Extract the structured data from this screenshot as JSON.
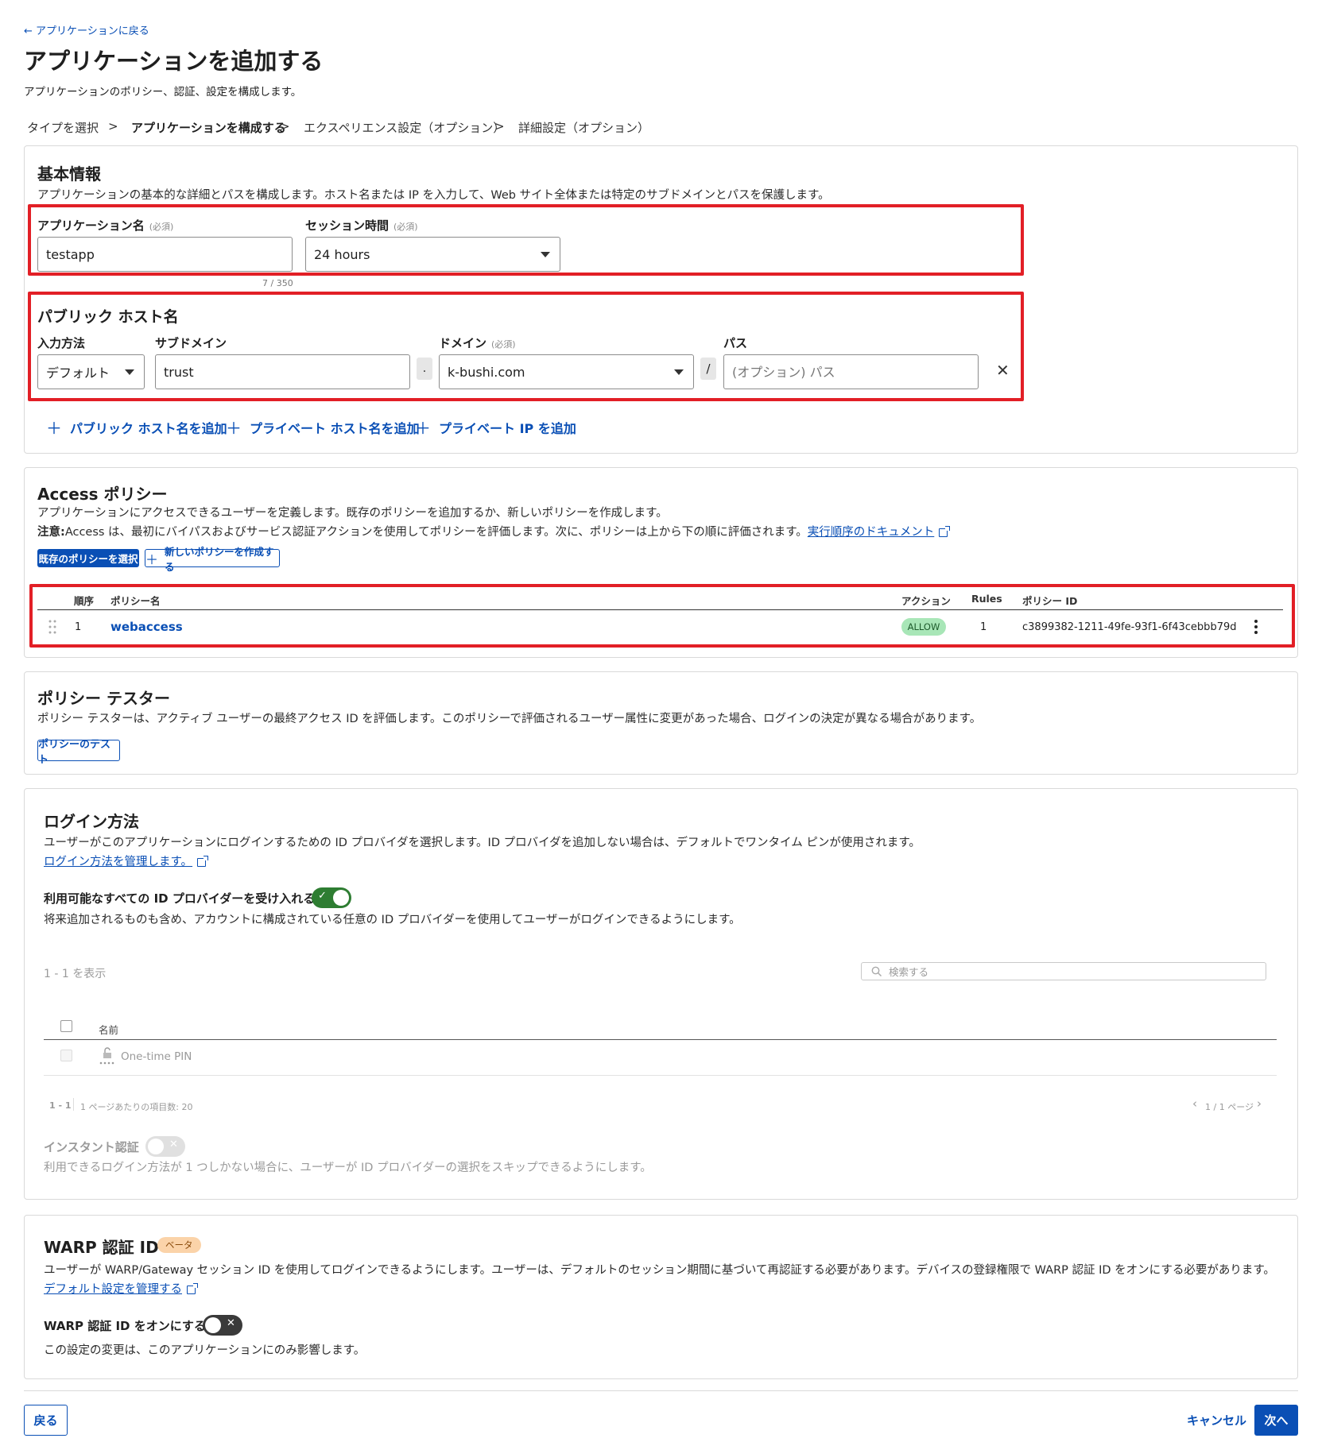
{
  "header": {
    "back_link": "← アプリケーションに戻る",
    "title": "アプリケーションを追加する",
    "subtitle": "アプリケーションのポリシー、認証、設定を構成します。"
  },
  "steps": [
    {
      "label": "タイプを選択",
      "active": false
    },
    {
      "label": "アプリケーションを構成する",
      "active": true
    },
    {
      "label": "エクスペリエンス設定（オプション）",
      "active": false
    },
    {
      "label": "詳細設定（オプション）",
      "active": false
    }
  ],
  "step_separator": ">",
  "basic": {
    "title": "基本情報",
    "description": "アプリケーションの基本的な詳細とパスを構成します。ホスト名または IP を入力して、Web サイト全体または特定のサブドメインとパスを保護します。",
    "app_name_label": "アプリケーション名",
    "required": "(必須)",
    "app_name_value": "testapp",
    "app_name_counter": "7 / 350",
    "session_label": "セッション時間",
    "session_value": "24 hours"
  },
  "public_host": {
    "title": "パブリック ホスト名",
    "input_method_label": "入力方法",
    "input_method_value": "デフォルト",
    "subdomain_label": "サブドメイン",
    "subdomain_value": "trust",
    "dot": ".",
    "domain_label": "ドメイン",
    "domain_value": "k-bushi.com",
    "slash": "/",
    "path_label": "パス",
    "path_placeholder": "(オプション) パス",
    "remove": "✕"
  },
  "add_links": {
    "plus": "＋",
    "public": "パブリック ホスト名を追加",
    "private_host": "プライベート ホスト名を追加",
    "private_ip": "プライベート IP を追加"
  },
  "access": {
    "title": "Access ポリシー",
    "description": "アプリケーションにアクセスできるユーザーを定義します。既存のポリシーを追加するか、新しいポリシーを作成します。",
    "note_label": "注意:",
    "note_text": "Access は、最初にバイパスおよびサービス認証アクションを使用してポリシーを評価します。次に、ポリシーは上から下の順に評価されます。",
    "note_link": "実行順序のドキュメント",
    "select_button": "既存のポリシーを選択",
    "create_button": "新しいポリシーを作成する",
    "table": {
      "headers": [
        "順序",
        "ポリシー名",
        "アクション",
        "Rules",
        "ポリシー ID"
      ],
      "rows": [
        {
          "order": "1",
          "name": "webaccess",
          "action": "ALLOW",
          "rules": "1",
          "id": "c3899382-1211-49fe-93f1-6f43cebbb79d"
        }
      ]
    }
  },
  "tester": {
    "title": "ポリシー テスター",
    "description": "ポリシー テスターは、アクティブ ユーザーの最終アクセス ID を評価します。このポリシーで評価されるユーザー属性に変更があった場合、ログインの決定が異なる場合があります。",
    "button": "ポリシーのテスト"
  },
  "login": {
    "title": "ログイン方法",
    "description": "ユーザーがこのアプリケーションにログインするための ID プロバイダを選択します。ID プロバイダを追加しない場合は、デフォルトでワンタイム ピンが使用されます。",
    "manage_link": "ログイン方法を管理します。",
    "accept_all_label": "利用可能なすべての ID プロバイダーを受け入れる",
    "accept_all_on": true,
    "accept_all_desc": "将来追加されるものも含め、アカウントに構成されている任意の ID プロバイダーを使用してユーザーがログインできるようにします。",
    "showing": "1 - 1 を表示",
    "search_placeholder": "検索する",
    "name_header": "名前",
    "idp_rows": [
      {
        "name": "One-time PIN"
      }
    ],
    "pager_range": "1 - 1",
    "pager_per_page": "1 ページあたりの項目数: 20",
    "pager_pages": "1 / 1 ページ",
    "instant_label": "インスタント認証",
    "instant_on": false,
    "instant_desc": "利用できるログイン方法が 1 つしかない場合に、ユーザーが ID プロバイダーの選択をスキップできるようにします。"
  },
  "warp": {
    "title": "WARP 認証 ID",
    "badge": "ベータ",
    "description": "ユーザーが WARP/Gateway セッション ID を使用してログインできるようにします。ユーザーは、デフォルトのセッション期間に基づいて再認証する必要があります。デバイスの登録権限で WARP 認証 ID をオンにする必要があります。",
    "manage_link": "デフォルト設定を管理する",
    "toggle_label": "WARP 認証 ID をオンにする",
    "toggle_on": false,
    "toggle_desc": "この設定の変更は、このアプリケーションにのみ影響します。"
  },
  "footer": {
    "back": "戻る",
    "cancel": "キャンセル",
    "next": "次へ"
  },
  "colors": {
    "accent": "#0a4fb5",
    "highlight_box": "#e21f26",
    "toggle_on": "#2e7d32",
    "allow_badge_bg": "#a8e6b7",
    "beta_badge_bg": "#fbd3a9"
  }
}
